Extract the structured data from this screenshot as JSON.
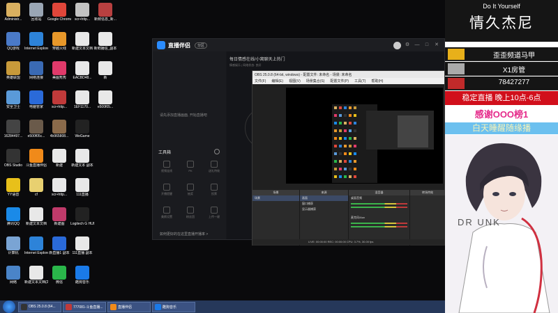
{
  "desktop": {
    "icons": [
      {
        "label": "Administr...",
        "color": "#d9b060",
        "col": 0,
        "row": 0
      },
      {
        "label": "回收站",
        "color": "#9aa6b4",
        "col": 1,
        "row": 0
      },
      {
        "label": "Google Chrome",
        "color": "#e0463a",
        "col": 2,
        "row": 0
      },
      {
        "label": "scr+http...",
        "color": "#c3c3c3",
        "col": 3,
        "row": 0
      },
      {
        "label": "新鲜信息_新...",
        "color": "#b84040",
        "col": 4,
        "row": 0
      },
      {
        "label": "QQ游戏",
        "color": "#4a7ac8",
        "col": 0,
        "row": 1
      },
      {
        "label": "Internet Explorer",
        "color": "#2d83d9",
        "col": 1,
        "row": 1
      },
      {
        "label": "穿越火线",
        "color": "#e8982a",
        "col": 2,
        "row": 1
      },
      {
        "label": "新建文本文档",
        "color": "#e8e8e8",
        "col": 3,
        "row": 1
      },
      {
        "label": "新鲜播信_副本",
        "color": "#e8e8e8",
        "col": 4,
        "row": 1
      },
      {
        "label": "英雄联盟",
        "color": "#c89a3a",
        "col": 0,
        "row": 2
      },
      {
        "label": "网络连接",
        "color": "#3a6ab4",
        "col": 1,
        "row": 2
      },
      {
        "label": "美图秀秀",
        "color": "#e03a6a",
        "col": 2,
        "row": 2
      },
      {
        "label": "EACBD48...",
        "color": "#e8e8e8",
        "col": 3,
        "row": 2
      },
      {
        "label": "新",
        "color": "#e8e8e8",
        "col": 4,
        "row": 2
      },
      {
        "label": "安全卫士",
        "color": "#5a9ad9",
        "col": 0,
        "row": 3
      },
      {
        "label": "电脑管家",
        "color": "#2a6ad9",
        "col": 1,
        "row": 3
      },
      {
        "label": "scr+http...",
        "color": "#c03a3a",
        "col": 2,
        "row": 3
      },
      {
        "label": "1EF1170...",
        "color": "#e8e8e8",
        "col": 3,
        "row": 3
      },
      {
        "label": "e500f05...",
        "color": "#e8e8e8",
        "col": 4,
        "row": 3
      },
      {
        "label": "16284497...",
        "color": "#444444",
        "col": 0,
        "row": 4
      },
      {
        "label": "e500f05c...",
        "color": "#6a5a4a",
        "col": 1,
        "row": 4
      },
      {
        "label": "4b965808...",
        "color": "#8a6a4a",
        "col": 2,
        "row": 4
      },
      {
        "label": "WeGame",
        "color": "#222222",
        "col": 3,
        "row": 4
      },
      {
        "label": "OBS Studio",
        "color": "#333333",
        "col": 0,
        "row": 5
      },
      {
        "label": "斗鱼直播伴侣",
        "color": "#f08a1a",
        "col": 1,
        "row": 5
      },
      {
        "label": "新建",
        "color": "#e8e8e8",
        "col": 2,
        "row": 5
      },
      {
        "label": "新建文本 副本",
        "color": "#e8e8e8",
        "col": 3,
        "row": 5
      },
      {
        "label": "YY语音",
        "color": "#e8c01a",
        "col": 0,
        "row": 6
      },
      {
        "label": "cf",
        "color": "#e8d070",
        "col": 1,
        "row": 6
      },
      {
        "label": "scr+http...",
        "color": "#e8e8e8",
        "col": 2,
        "row": 6
      },
      {
        "label": "111直播",
        "color": "#e8e8e8",
        "col": 3,
        "row": 6
      },
      {
        "label": "腾讯QQ",
        "color": "#1a8ae8",
        "col": 0,
        "row": 7
      },
      {
        "label": "新建文本文档",
        "color": "#e8e8e8",
        "col": 1,
        "row": 7
      },
      {
        "label": "新建图",
        "color": "#c03a6a",
        "col": 2,
        "row": 7
      },
      {
        "label": "Logitech G HUB",
        "color": "#222222",
        "col": 3,
        "row": 7
      },
      {
        "label": "计算机",
        "color": "#7aa4d4",
        "col": 0,
        "row": 8
      },
      {
        "label": "Internet Explorer",
        "color": "#2d83d9",
        "col": 1,
        "row": 8
      },
      {
        "label": "新直播1 副本",
        "color": "#2a6ad9",
        "col": 2,
        "row": 8
      },
      {
        "label": "111直播 副本",
        "color": "#e8e8e8",
        "col": 3,
        "row": 8
      },
      {
        "label": "网络",
        "color": "#4a84c8",
        "col": 0,
        "row": 9
      },
      {
        "label": "新建文本文档(2)",
        "color": "#e8e8e8",
        "col": 1,
        "row": 9
      },
      {
        "label": "微信",
        "color": "#2ab64a",
        "col": 2,
        "row": 9
      },
      {
        "label": "酷狗音乐",
        "color": "#1a7ae8",
        "col": 3,
        "row": 9
      }
    ]
  },
  "live_app": {
    "title": "直播伴侣",
    "badge": "分区",
    "stream_title": "每日情感在线/小窝聊天上热门",
    "stream_sub": "情感娱乐 | 网络状态: 良好",
    "hint": "请先添加直播画面, 开始直播吧",
    "tools_label": "工具箱",
    "tools": [
      "视频连线",
      "PK",
      "送礼特效",
      "开播提醒",
      "抽奖",
      "投票",
      "美颜设置",
      "粉丝团",
      "上传一键"
    ],
    "status": "如何更好的在这里直播开播率 >"
  },
  "obs": {
    "title": "OBS 25.0.8 (64-bit, windows) - 配置文件: 未命名 - 场景: 未命名",
    "menu": [
      "文件(F)",
      "编辑(E)",
      "视图(V)",
      "场景集合(S)",
      "配置文件(P)",
      "工具(T)",
      "帮助(H)"
    ],
    "panels": {
      "scenes": {
        "header": "场景",
        "items": [
          "场景"
        ]
      },
      "sources": {
        "header": "来源",
        "items": [
          "画面",
          "窗口捕获",
          "显示器捕获"
        ]
      },
      "mixer": {
        "header": "混音器",
        "tracks": [
          "桌面音频",
          "麦克风/Aux"
        ]
      },
      "transitions": {
        "header": "转场特效"
      }
    },
    "status": "LIVE: 00:00:00  REC: 00:00:00  CPU: 3.7%, 30.00 fps"
  },
  "overlay": {
    "diy": "Do It Yourself",
    "name": "情久杰尼",
    "fans": [
      {
        "label": "歪歪频道马甲",
        "color": "#e8b01a"
      },
      {
        "label": "X1房管",
        "color": "#aaaaaa"
      },
      {
        "label": "78427277",
        "color": "#c02a2a"
      }
    ],
    "live_time": "稳定直播  晚上10点-6点",
    "thanks": "感谢OOO榜1",
    "random_play": "白天睡醒随缘播",
    "art_text": "DR    UNK"
  },
  "taskbar": {
    "items": [
      {
        "label": "OBS 25.0.8 (64...",
        "color": "#333333"
      },
      {
        "label": "777081-斗鱼直播...",
        "color": "#c03a3a"
      },
      {
        "label": "直播伴侣",
        "color": "#f08a1a"
      },
      {
        "label": "酷狗音乐",
        "color": "#1a7ae8"
      }
    ]
  },
  "colors": {
    "accent_blue": "#2a8cff",
    "live_red": "#d10f1b",
    "thanks_pink": "#e52a8a",
    "random_blue": "#6cc0ef"
  }
}
